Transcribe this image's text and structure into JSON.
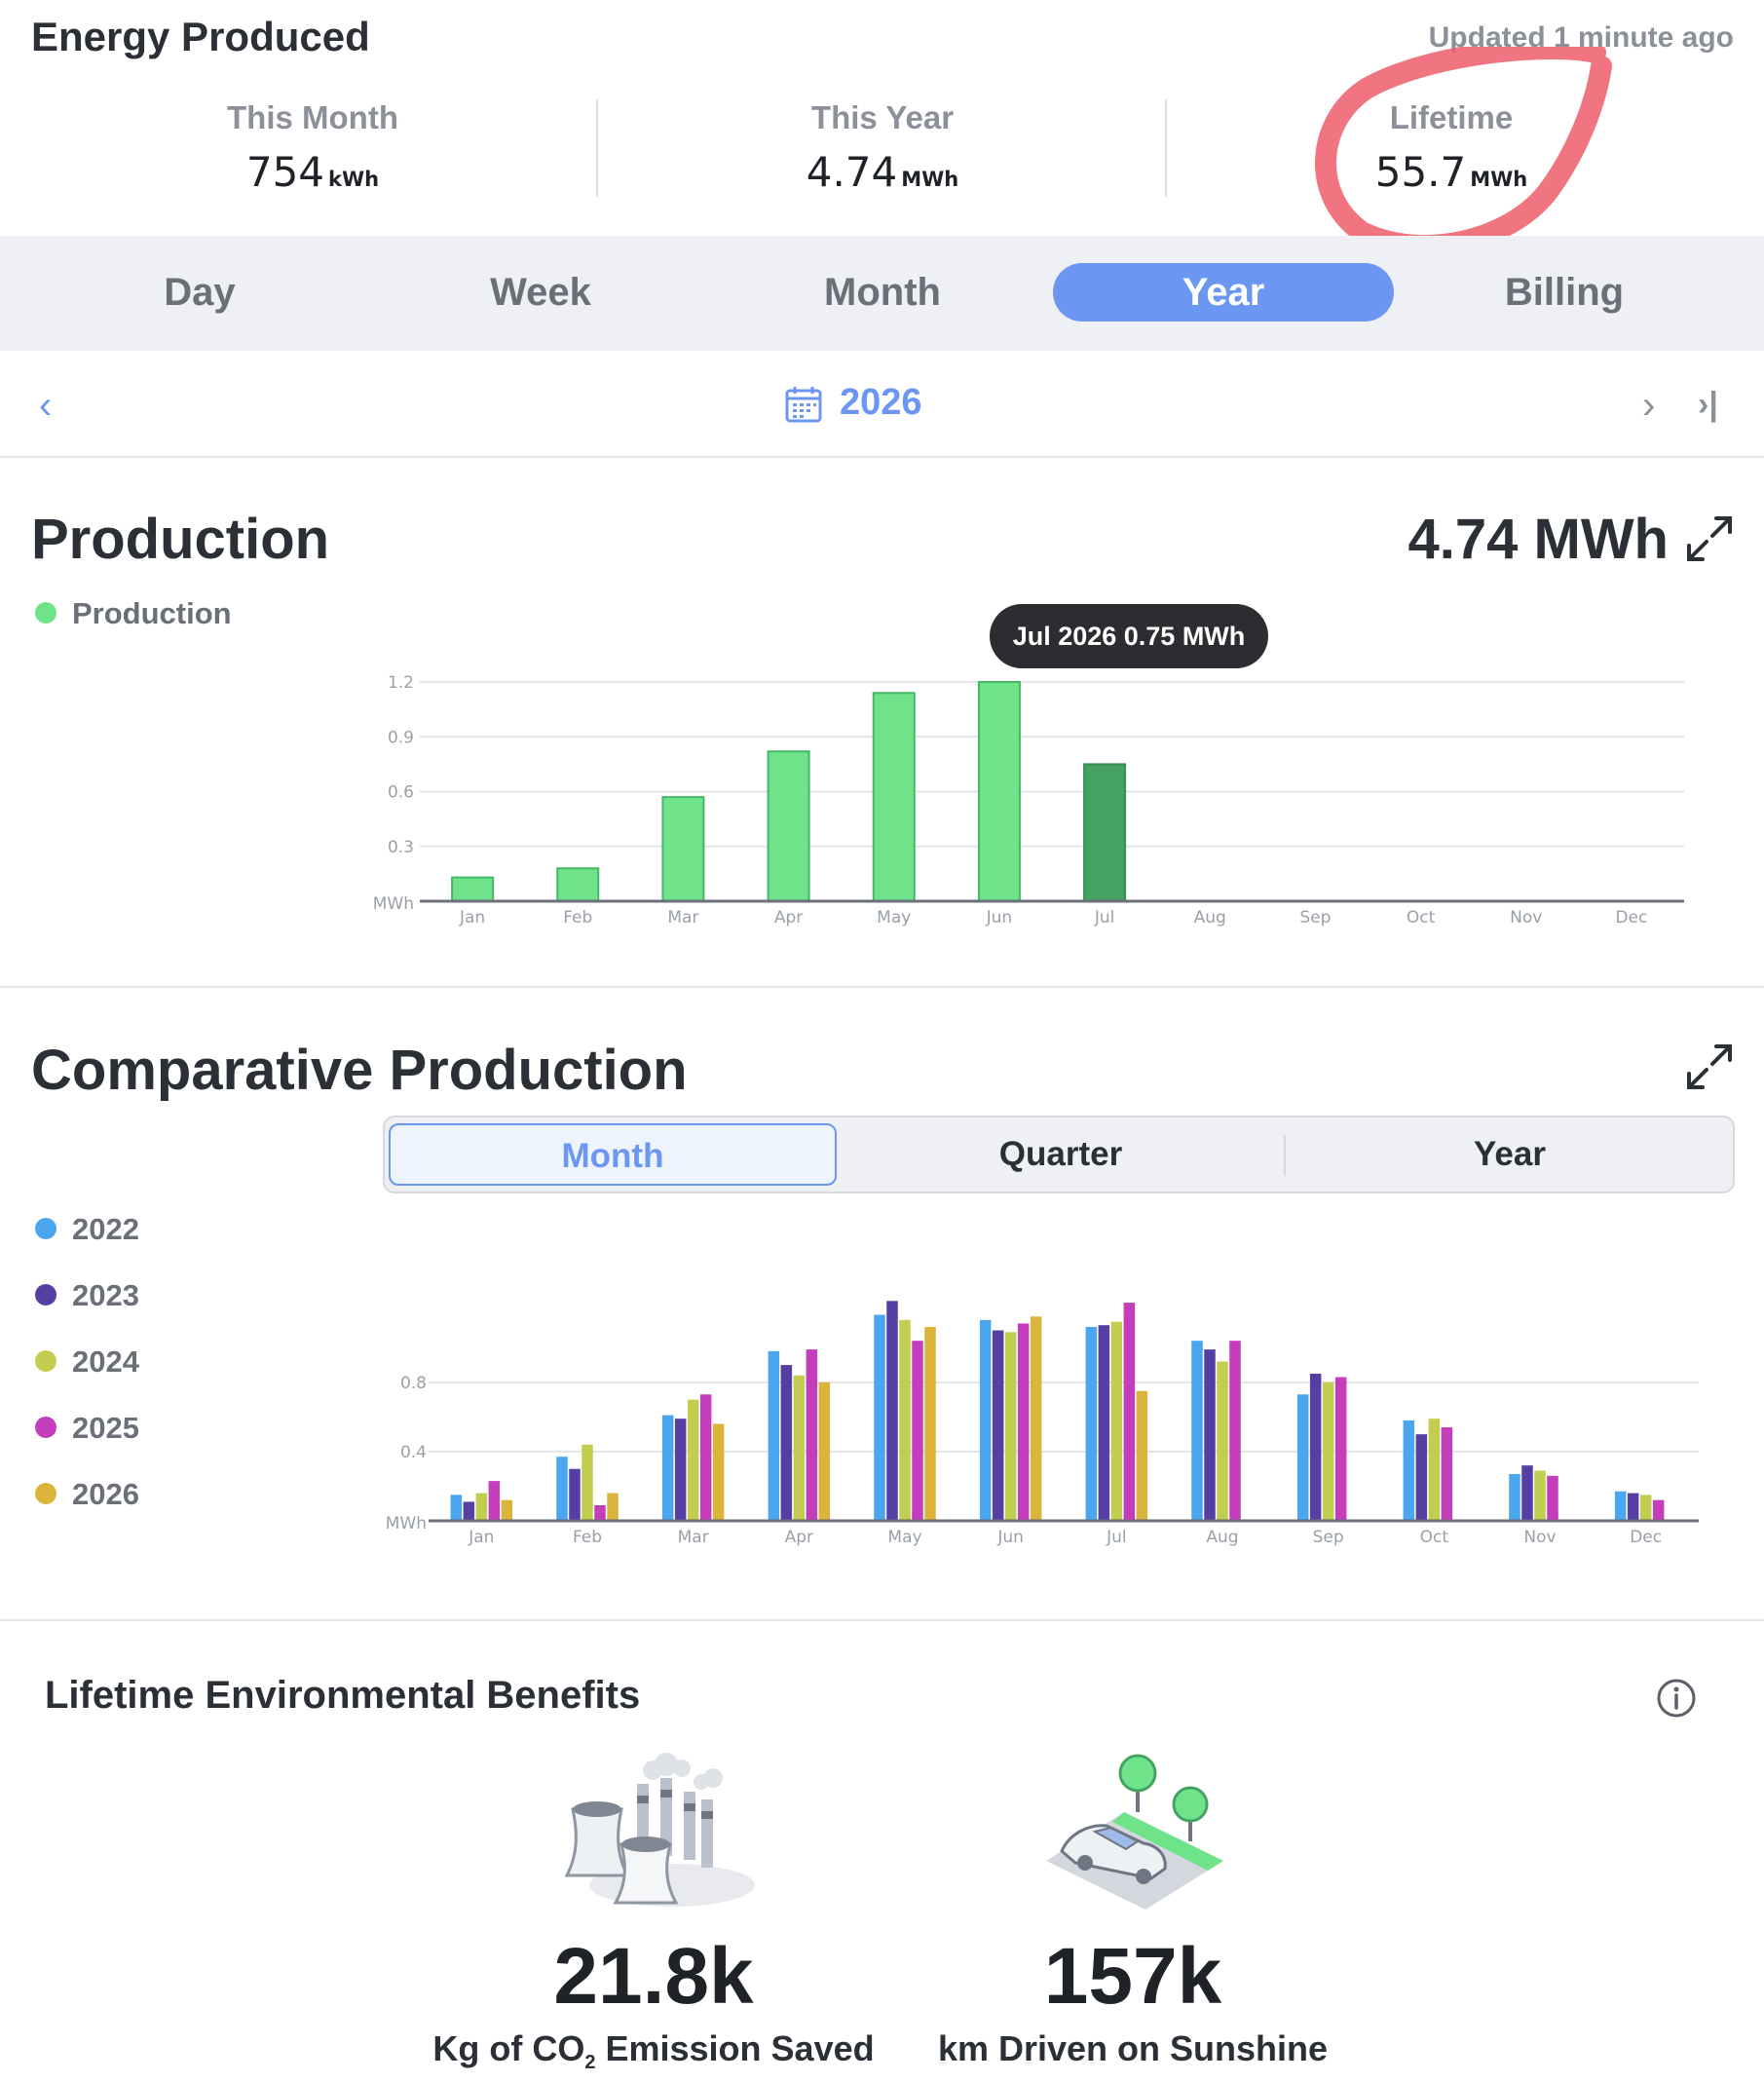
{
  "header": {
    "title": "Energy Produced",
    "updated": "Updated 1 minute ago",
    "stats": [
      {
        "label": "This Month",
        "value": "754",
        "unit": "kWh"
      },
      {
        "label": "This Year",
        "value": "4.74",
        "unit": "MWh"
      },
      {
        "label": "Lifetime",
        "value": "55.7",
        "unit": "MWh"
      }
    ]
  },
  "tabs": [
    "Day",
    "Week",
    "Month",
    "Year",
    "Billing"
  ],
  "active_tab": "Year",
  "date_nav": {
    "label": "2026"
  },
  "production": {
    "title": "Production",
    "total": "4.74 MWh",
    "legend": "Production",
    "tooltip": "Jul 2026 0.75 MWh",
    "colors": {
      "bar": "#6ee38a",
      "bar_highlight": "#45a262",
      "legend": "#6ee38a"
    }
  },
  "comparative": {
    "title": "Comparative Production",
    "segments": [
      "Month",
      "Quarter",
      "Year"
    ],
    "active_segment": "Month",
    "legend": [
      {
        "label": "2022",
        "color": "#4aa6ee"
      },
      {
        "label": "2023",
        "color": "#563fa3"
      },
      {
        "label": "2024",
        "color": "#c3cd50"
      },
      {
        "label": "2025",
        "color": "#c43dbb"
      },
      {
        "label": "2026",
        "color": "#dbb43c"
      }
    ]
  },
  "environment": {
    "title": "Lifetime Environmental Benefits",
    "co2_value": "21.8k",
    "co2_label_pre": "Kg of CO",
    "co2_label_sub": "2",
    "co2_label_post": " Emission Saved",
    "km_value": "157k",
    "km_label": "km Driven on Sunshine",
    "icons": [
      "info-icon",
      "factory-icon",
      "car-icon",
      "expand-icon",
      "calendar-icon"
    ]
  },
  "chart_data": [
    {
      "type": "bar",
      "title": "Production",
      "categories": [
        "Jan",
        "Feb",
        "Mar",
        "Apr",
        "May",
        "Jun",
        "Jul",
        "Aug",
        "Sep",
        "Oct",
        "Nov",
        "Dec"
      ],
      "values": [
        0.13,
        0.18,
        0.57,
        0.82,
        1.14,
        1.2,
        0.75,
        0,
        0,
        0,
        0,
        0
      ],
      "yticks": [
        "1.2",
        "0.9",
        "0.6",
        "0.3"
      ],
      "yunit": "MWh",
      "ylim": [
        0,
        1.2
      ],
      "grid": true,
      "highlight": "Jul"
    },
    {
      "type": "bar",
      "categories": [
        "Jan",
        "Feb",
        "Mar",
        "Apr",
        "May",
        "Jun",
        "Jul",
        "Aug",
        "Sep",
        "Oct",
        "Nov",
        "Dec"
      ],
      "yticks": [
        "0.8",
        "0.4"
      ],
      "yunit": "MWh",
      "ylim": [
        0,
        1.3
      ],
      "grid": true,
      "series": [
        {
          "name": "2022",
          "values": [
            0.15,
            0.37,
            0.61,
            0.98,
            1.19,
            1.16,
            1.12,
            1.04,
            0.73,
            0.58,
            0.27,
            0.17
          ]
        },
        {
          "name": "2023",
          "values": [
            0.11,
            0.3,
            0.59,
            0.9,
            1.27,
            1.1,
            1.13,
            0.99,
            0.85,
            0.5,
            0.32,
            0.16
          ]
        },
        {
          "name": "2024",
          "values": [
            0.16,
            0.44,
            0.7,
            0.84,
            1.16,
            1.09,
            1.15,
            0.92,
            0.8,
            0.59,
            0.29,
            0.15
          ]
        },
        {
          "name": "2025",
          "values": [
            0.23,
            0.09,
            0.73,
            0.99,
            1.04,
            1.14,
            1.26,
            1.04,
            0.83,
            0.54,
            0.26,
            0.12
          ]
        },
        {
          "name": "2026",
          "values": [
            0.12,
            0.16,
            0.56,
            0.8,
            1.12,
            1.18,
            0.75,
            0,
            0,
            0,
            0,
            0
          ]
        }
      ]
    }
  ]
}
